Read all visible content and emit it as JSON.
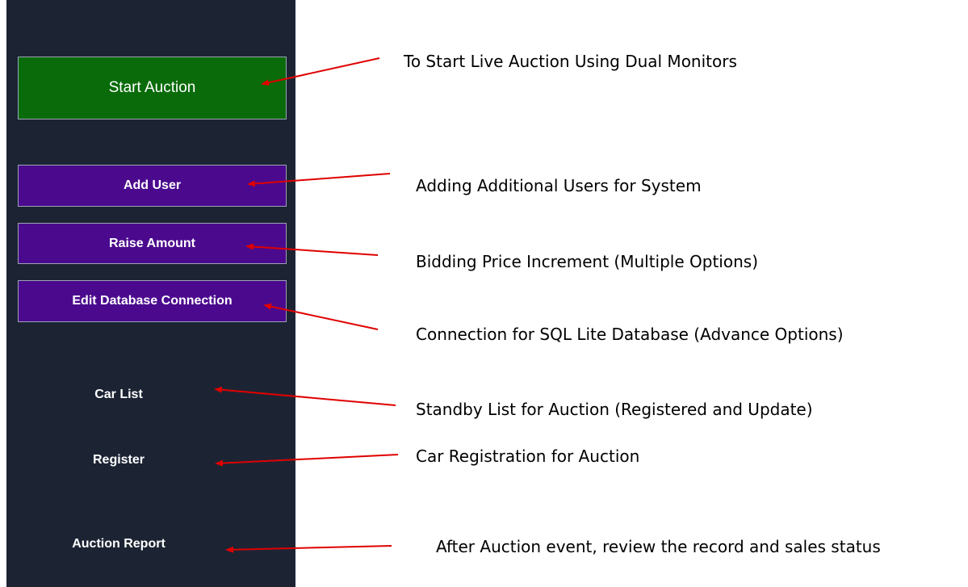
{
  "sidebar": {
    "start_auction": "Start Auction",
    "add_user": "Add User",
    "raise_amount": "Raise Amount",
    "edit_db": "Edit Database Connection",
    "car_list": "Car List",
    "register": "Register",
    "auction_report": "Auction Report"
  },
  "annotations": {
    "start_auction": "To Start Live Auction Using Dual Monitors",
    "add_user": "Adding Additional Users for System",
    "raise_amount": "Bidding Price Increment (Multiple Options)",
    "edit_db": "Connection for SQL Lite Database (Advance Options)",
    "car_list": "Standby List for Auction (Registered and Update)",
    "register": "Car Registration for Auction",
    "auction_report": "After Auction event, review the record and sales status"
  },
  "colors": {
    "sidebar_bg": "#1c2434",
    "start_button": "#0a6b0a",
    "purple_button": "#4b0a8e",
    "arrow": "#e00000"
  }
}
